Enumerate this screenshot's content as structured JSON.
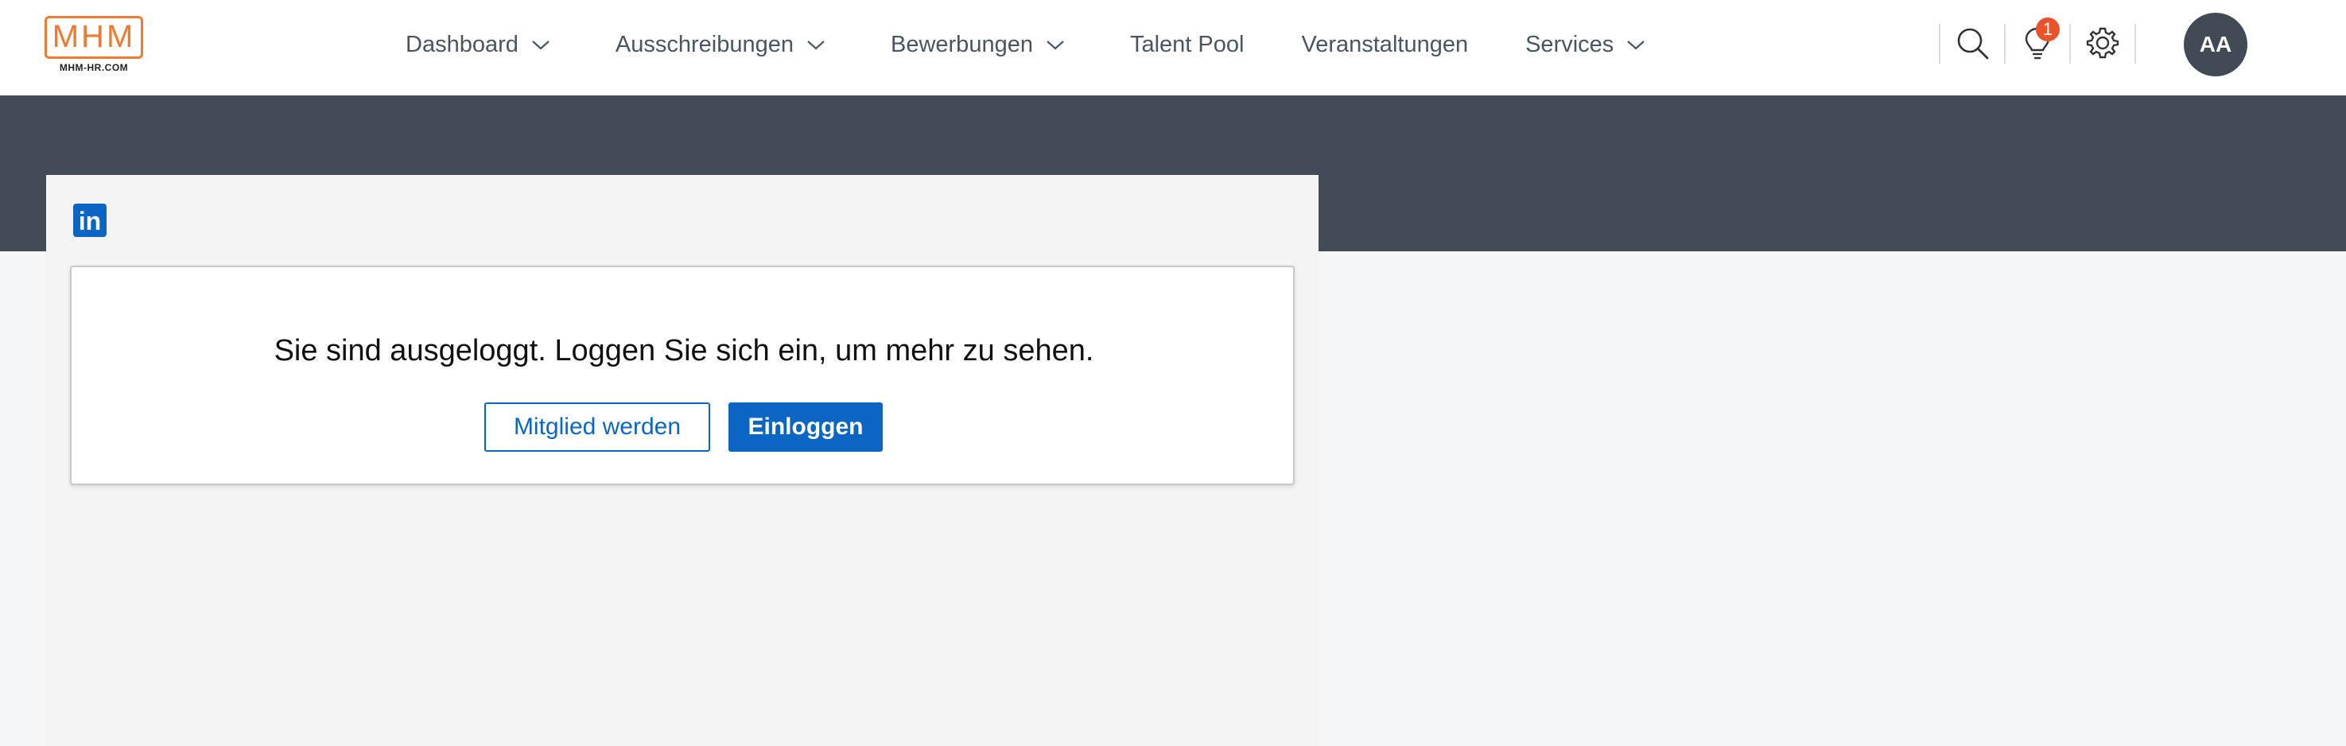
{
  "brand": {
    "logo_letters": "MHM",
    "logo_sub": "MHM-HR.COM",
    "color": "#f07a30"
  },
  "nav": {
    "items": [
      {
        "label": "Dashboard",
        "has_dropdown": true
      },
      {
        "label": "Ausschreibungen",
        "has_dropdown": true
      },
      {
        "label": "Bewerbungen",
        "has_dropdown": true
      },
      {
        "label": "Talent Pool",
        "has_dropdown": false
      },
      {
        "label": "Veranstaltungen",
        "has_dropdown": false
      },
      {
        "label": "Services",
        "has_dropdown": true
      }
    ]
  },
  "header_actions": {
    "search_icon": "search-icon",
    "notifications_icon": "lightbulb-icon",
    "notification_count": "1",
    "settings_icon": "gear-icon",
    "avatar_initials": "AA"
  },
  "linkedin": {
    "icon": "linkedin-icon",
    "icon_text": "in",
    "color": "#0a66c2"
  },
  "login_card": {
    "message": "Sie sind ausgeloggt. Loggen Sie sich ein, um mehr zu sehen.",
    "join_label": "Mitglied werden",
    "login_label": "Einloggen"
  },
  "colors": {
    "banner": "#424b56",
    "badge": "#e9532b",
    "avatar_bg": "#414a55"
  }
}
